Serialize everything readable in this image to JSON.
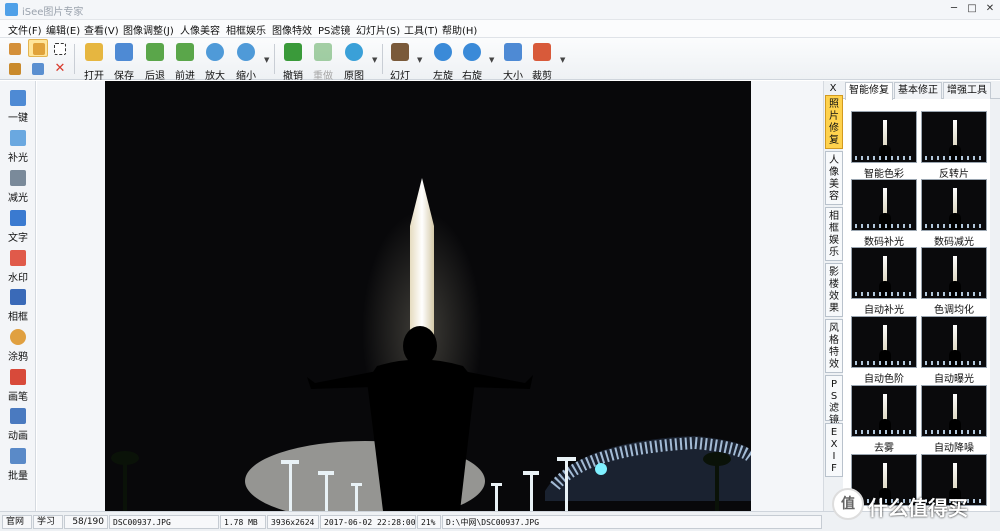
{
  "window": {
    "title": "iSee图片专家",
    "controls": {
      "minimize": "─",
      "maximize": "□",
      "close": "✕"
    }
  },
  "menu": [
    "文件(F)",
    "编辑(E)",
    "查看(V)",
    "图像调整(J)",
    "人像美容",
    "相框娱乐",
    "图像特效",
    "PS滤镜",
    "幻灯片(S)",
    "工具(T)",
    "帮助(H)"
  ],
  "toolbar": {
    "small_buttons": [
      {
        "name": "thumbnail-view-icon",
        "color": "#d4903a"
      },
      {
        "name": "hand-tool-icon",
        "color": "#e0a23a",
        "active": true
      },
      {
        "name": "select-rect-icon",
        "color": "#ffffff"
      },
      {
        "name": "batch-icon",
        "color": "#c98a2c"
      },
      {
        "name": "compare-icon",
        "color": "#5a8fd0"
      },
      {
        "name": "delete-x-icon",
        "color": "#d83a2c"
      }
    ],
    "buttons": [
      {
        "label": "打开",
        "icon": "open-folder-icon",
        "color": "#e6b640"
      },
      {
        "label": "保存",
        "icon": "save-disk-icon",
        "color": "#4e8ad4"
      },
      {
        "label": "后退",
        "icon": "back-photo-icon",
        "color": "#5aa64a"
      },
      {
        "label": "前进",
        "icon": "forward-photo-icon",
        "color": "#5aa64a"
      },
      {
        "label": "放大",
        "icon": "zoom-in-icon",
        "color": "#4f9ad8"
      },
      {
        "label": "缩小",
        "icon": "zoom-out-icon",
        "color": "#4f9ad8"
      },
      {
        "label": "撤销",
        "icon": "undo-arrow-icon",
        "color": "#3a9a3a"
      },
      {
        "label": "重做",
        "icon": "redo-arrow-icon",
        "color": "#3a9a3a",
        "disabled": true
      },
      {
        "label": "原图",
        "icon": "original-ring-icon",
        "color": "#3aa0d8"
      },
      {
        "label": "幻灯",
        "icon": "slideshow-film-icon",
        "color": "#7a5a3a"
      },
      {
        "label": "左旋",
        "icon": "rotate-left-icon",
        "color": "#3a8ad8"
      },
      {
        "label": "右旋",
        "icon": "rotate-right-icon",
        "color": "#3a8ad8"
      },
      {
        "label": "大小",
        "icon": "resize-icon",
        "color": "#4e8ad4"
      },
      {
        "label": "裁剪",
        "icon": "crop-icon",
        "color": "#d85a3a"
      }
    ]
  },
  "left_tools": [
    {
      "label": "一键",
      "icon": "one-click-icon",
      "color": "#4e8ad4"
    },
    {
      "label": "补光",
      "icon": "fill-light-icon",
      "color": "#6aa8e0"
    },
    {
      "label": "减光",
      "icon": "reduce-light-icon",
      "color": "#7a8a9a"
    },
    {
      "label": "文字",
      "icon": "text-tool-icon",
      "color": "#3a7ad0"
    },
    {
      "label": "水印",
      "icon": "watermark-icon",
      "color": "#e05a4a"
    },
    {
      "label": "相框",
      "icon": "frame-icon",
      "color": "#3a6ab8"
    },
    {
      "label": "涂鸦",
      "icon": "palette-icon",
      "color": "#e0a040"
    },
    {
      "label": "画笔",
      "icon": "brush-icon",
      "color": "#d84a3a"
    },
    {
      "label": "动画",
      "icon": "animation-icon",
      "color": "#4a7ac0"
    },
    {
      "label": "批量",
      "icon": "batch-process-icon",
      "color": "#5a8ac8"
    }
  ],
  "side_tabs": [
    {
      "label": "照片修复",
      "active": true
    },
    {
      "label": "人像美容"
    },
    {
      "label": "相框娱乐"
    },
    {
      "label": "影楼效果"
    },
    {
      "label": "风格特效"
    },
    {
      "label": "PS滤镜"
    },
    {
      "label": "EXIF"
    }
  ],
  "side_close": "X",
  "right_tabs": [
    {
      "label": "智能修复",
      "active": true
    },
    {
      "label": "基本修正"
    },
    {
      "label": "增强工具"
    }
  ],
  "effects": [
    "智能色彩",
    "反转片",
    "数码补光",
    "数码减光",
    "自动补光",
    "色调均化",
    "自动色阶",
    "自动曝光",
    "去雾",
    "自动降噪",
    "",
    ""
  ],
  "status": {
    "site": "官网",
    "learn": "学习",
    "index": "58/190",
    "filename": "DSC00937.JPG",
    "filesize": "1.78 MB",
    "dimensions": "3936x2624",
    "datetime": "2017-06-02 22:28:00",
    "zoom": "21%",
    "path": "D:\\中网\\DSC00937.JPG"
  },
  "watermark": {
    "badge": "值",
    "text": "什么值得买"
  }
}
